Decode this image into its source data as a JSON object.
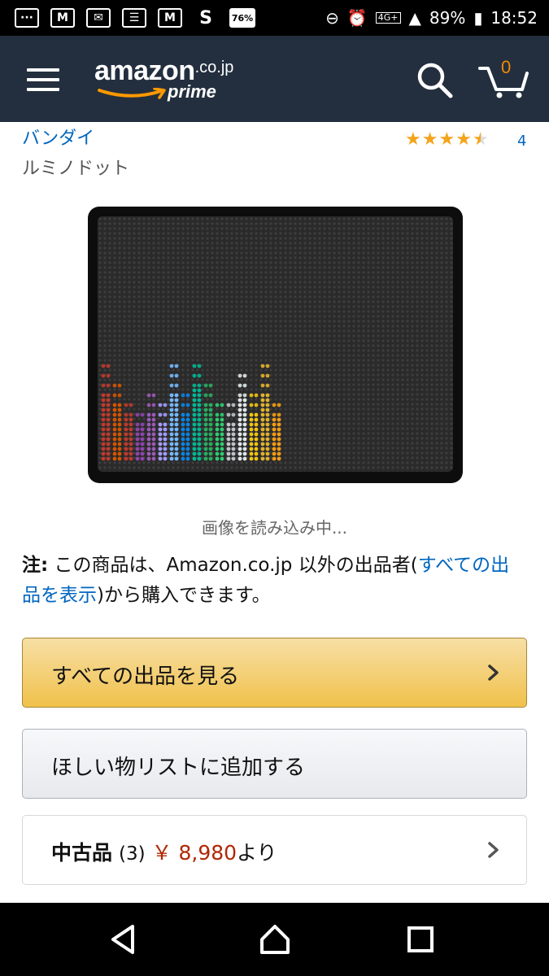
{
  "status_bar": {
    "battery_saver": "76%",
    "network": "4G+",
    "battery": "89%",
    "time": "18:52"
  },
  "header": {
    "logo_word": "amazon",
    "logo_tld": ".co.jp",
    "logo_prime": "prime",
    "cart_count": "0",
    "colors": {
      "bg": "#232f3e",
      "accent": "#f08804"
    }
  },
  "product": {
    "brand": "バンダイ",
    "name": "ルミノドット",
    "rating_stars": 4.5,
    "rating_count": "4",
    "loading_text": "画像を読み込み中..."
  },
  "note": {
    "label": "注:",
    "text_before": " この商品は、Amazon.co.jp 以外の出品者(",
    "link": "すべての出品を表示",
    "text_after": ")から購入できます。"
  },
  "buttons": {
    "see_all_offers": "すべての出品を見る",
    "add_to_wishlist": "ほしい物リストに追加する"
  },
  "used": {
    "title": "中古品",
    "count": "(3)",
    "price": "￥ 8,980",
    "suffix": "より"
  }
}
